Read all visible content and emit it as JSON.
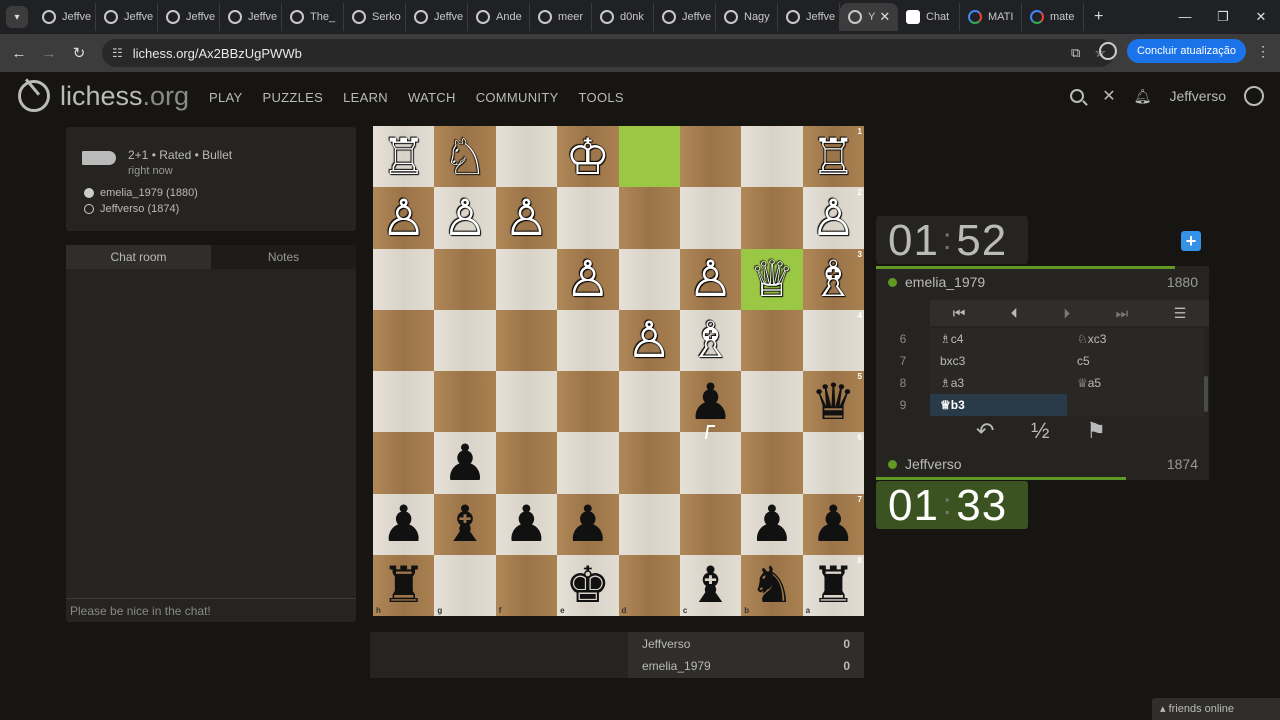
{
  "browser": {
    "tabs": [
      "Jeffve",
      "Jeffve",
      "Jeffve",
      "Jeffve",
      "The_",
      "Serko",
      "Jeffve",
      "Ande",
      "meer",
      "d0nk",
      "Jeffve",
      "Nagy",
      "Jeffve",
      "Y",
      "Chat",
      "MATI",
      "mate"
    ],
    "active_tab_index": 13,
    "url": "lichess.org/Ax2BBzUgPWWb",
    "update_button": "Concluir atualização"
  },
  "site": {
    "logo_main": "lichess",
    "logo_suffix": ".org",
    "nav": [
      "PLAY",
      "PUZZLES",
      "LEARN",
      "WATCH",
      "COMMUNITY",
      "TOOLS"
    ],
    "username": "Jeffverso"
  },
  "game": {
    "type": "2+1 • Rated • Bullet",
    "time": "right now",
    "white_player": "emelia_1979 (1880)",
    "black_player": "Jeffverso (1874)"
  },
  "chat": {
    "tab_chat": "Chat room",
    "tab_notes": "Notes",
    "placeholder": "Please be nice in the chat!"
  },
  "board": {
    "ranks": [
      "1",
      "2",
      "3",
      "4",
      "5",
      "6",
      "7",
      "8"
    ],
    "files": [
      "h",
      "g",
      "f",
      "e",
      "d",
      "c",
      "b",
      "a"
    ],
    "rows": [
      [
        "wR",
        "wN",
        "",
        "wK",
        "",
        "",
        "",
        "wR"
      ],
      [
        "wP",
        "wP",
        "wP",
        "",
        "",
        "",
        "",
        "wP"
      ],
      [
        "",
        "",
        "",
        "wP",
        "",
        "wP",
        "wQ",
        "wB"
      ],
      [
        "",
        "",
        "",
        "",
        "wP",
        "wB",
        "",
        ""
      ],
      [
        "",
        "",
        "",
        "",
        "",
        "bP",
        "",
        "bQ"
      ],
      [
        "",
        "bP",
        "",
        "",
        "",
        "",
        "",
        ""
      ],
      [
        "bP",
        "bB",
        "bP",
        "bP",
        "",
        "",
        "bP",
        "bP"
      ],
      [
        "bR",
        "",
        "",
        "bK",
        "",
        "bB",
        "bN",
        "bR"
      ]
    ],
    "highlights": [
      "r0c4",
      "r2c6"
    ]
  },
  "crosstable": {
    "p1": "Jeffverso",
    "p1_score": "0",
    "p2": "emelia_1979",
    "p2_score": "0"
  },
  "clocks": {
    "top_min": "01",
    "top_sec": "52",
    "bottom_min": "01",
    "bottom_sec": "33"
  },
  "players": {
    "top_name": "emelia_1979",
    "top_rating": "1880",
    "bottom_name": "Jeffverso",
    "bottom_rating": "1874"
  },
  "moves": [
    {
      "no": "6",
      "white": "♗c4",
      "black": "♘xc3"
    },
    {
      "no": "7",
      "white": "bxc3",
      "black": "c5"
    },
    {
      "no": "8",
      "white": "♗a3",
      "black": "♕a5"
    },
    {
      "no": "9",
      "white": "♕b3",
      "black": ""
    }
  ],
  "actions": {
    "takeback": "↶",
    "draw": "½",
    "resign": "⚑"
  },
  "friends": "friends online"
}
